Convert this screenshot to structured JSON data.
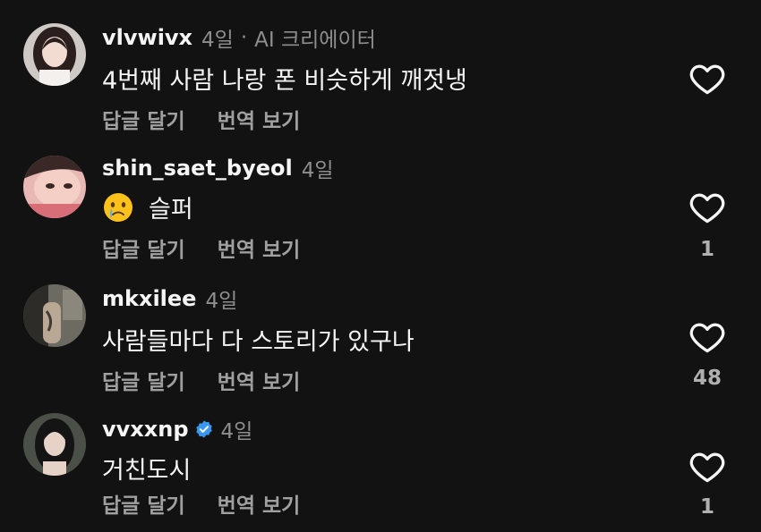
{
  "comments": [
    {
      "username": "vlvwivx",
      "time": "4일",
      "separator": "·",
      "creator_label": "AI 크리에이터",
      "text": "4번째 사람 나랑 폰 비슷하게 깨젓냉",
      "reply_label": "답글 달기",
      "translate_label": "번역 보기",
      "like_count": ""
    },
    {
      "username": "shin_saet_byeol",
      "time": "4일",
      "emoji": "crying-face-emoji",
      "text": "슬퍼",
      "reply_label": "답글 달기",
      "translate_label": "번역 보기",
      "like_count": "1"
    },
    {
      "username": "mkxilee",
      "time": "4일",
      "text": "사람들마다 다 스토리가 있구나",
      "reply_label": "답글 달기",
      "translate_label": "번역 보기",
      "like_count": "48"
    },
    {
      "username": "vvxxnp",
      "verified": true,
      "time": "4일",
      "text": "거친도시",
      "reply_label": "답글 달기",
      "translate_label": "번역 보기",
      "like_count": "1"
    }
  ],
  "colors": {
    "background": "#121212",
    "primary_text": "#f5f5f5",
    "secondary_text": "#8e8e8e",
    "verified_blue": "#3897f0"
  },
  "icons": {
    "like": "heart-outline-icon",
    "verified": "verified-badge-icon"
  }
}
